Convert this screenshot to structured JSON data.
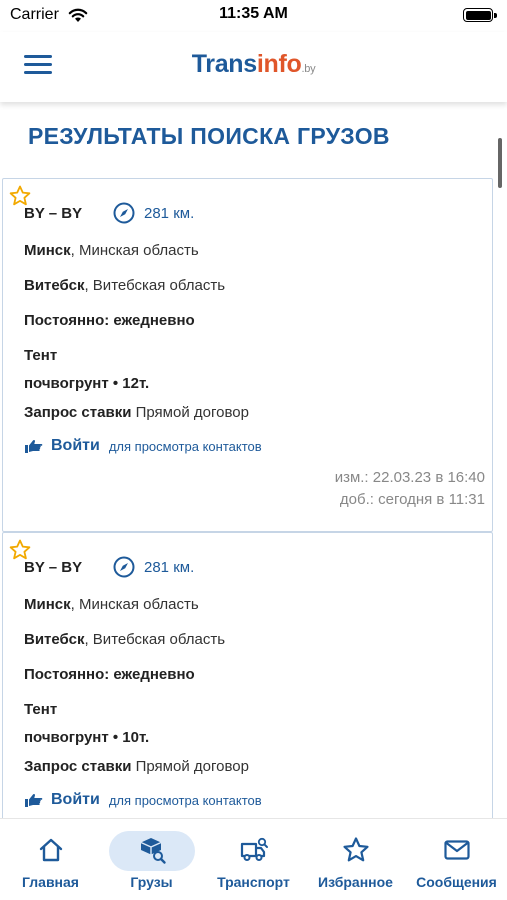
{
  "status_bar": {
    "carrier": "Carrier",
    "time": "11:35 AM"
  },
  "header": {
    "logo_part1": "Trans",
    "logo_part2": "info",
    "logo_part3": ".by"
  },
  "page_title": "РЕЗУЛЬТАТЫ ПОИСКА ГРУЗОВ",
  "cards": [
    {
      "route": "BY – BY",
      "distance": "281 км.",
      "from_city": "Минск",
      "from_region": ", Минская область",
      "to_city": "Витебск",
      "to_region": ", Витебская область",
      "schedule_label": "Постоянно",
      "schedule_value": ": ежедневно",
      "truck_type": "Тент",
      "cargo": "почвогрунт • 12т.",
      "rate_label": "Запрос ставки",
      "rate_value": " Прямой договор",
      "login_label": "Войти",
      "login_hint": "для просмотра контактов",
      "modified": "изм.: 22.03.23 в 16:40",
      "added": "доб.: сегодня в 11:31"
    },
    {
      "route": "BY – BY",
      "distance": "281 км.",
      "from_city": "Минск",
      "from_region": ", Минская область",
      "to_city": "Витебск",
      "to_region": ", Витебская область",
      "schedule_label": "Постоянно",
      "schedule_value": ": ежедневно",
      "truck_type": "Тент",
      "cargo": "почвогрунт • 10т.",
      "rate_label": "Запрос ставки",
      "rate_value": " Прямой договор",
      "login_label": "Войти",
      "login_hint": "для просмотра контактов"
    }
  ],
  "tabbar": {
    "items": [
      {
        "label": "Главная",
        "icon": "home-icon",
        "active": false
      },
      {
        "label": "Грузы",
        "icon": "cargo-box-search-icon",
        "active": true
      },
      {
        "label": "Транспорт",
        "icon": "truck-search-icon",
        "active": false
      },
      {
        "label": "Избранное",
        "icon": "star-icon",
        "active": false
      },
      {
        "label": "Сообщения",
        "icon": "envelope-icon",
        "active": false
      }
    ]
  },
  "colors": {
    "accent": "#1e5a9a",
    "logo_orange": "#e0562a",
    "star": "#f2a900",
    "active_tab_bg": "#dbe8f7"
  }
}
